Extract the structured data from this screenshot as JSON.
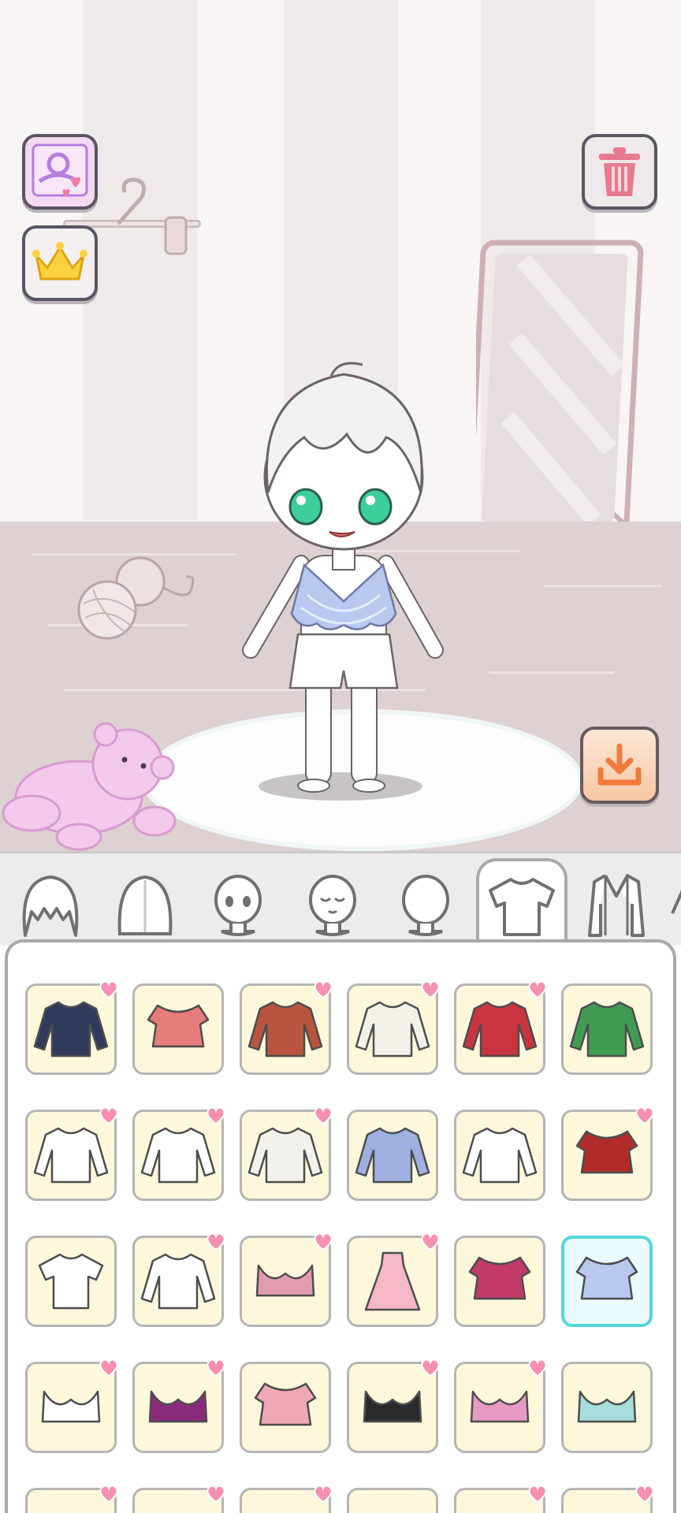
{
  "scene": {
    "buttons": [
      {
        "name": "diary-button",
        "icon": "heart-diary-icon"
      },
      {
        "name": "vip-button",
        "icon": "crown-icon"
      },
      {
        "name": "trash-button",
        "icon": "trash-icon"
      },
      {
        "name": "save-button",
        "icon": "download-icon"
      }
    ],
    "character": {
      "hair_color": "#f2f2f2",
      "eye_color": "#3ccf9a",
      "top_color": "#b8c8ee",
      "shorts_color": "#ffffff"
    }
  },
  "tabs": [
    {
      "name": "tab-hair-front",
      "icon": "hair-bangs-icon"
    },
    {
      "name": "tab-hair-back",
      "icon": "hair-back-icon"
    },
    {
      "name": "tab-eyes",
      "icon": "face-eyes-icon"
    },
    {
      "name": "tab-mouth",
      "icon": "face-mouth-icon"
    },
    {
      "name": "tab-face",
      "icon": "face-base-icon"
    },
    {
      "name": "tab-tops",
      "icon": "tshirt-icon",
      "active": true
    },
    {
      "name": "tab-jackets",
      "icon": "jacket-icon"
    },
    {
      "name": "tab-more",
      "icon": "partial-icon"
    }
  ],
  "items": [
    [
      {
        "icon": "sailor-jacket-icon",
        "color": "#2f3a5c",
        "heart": true
      },
      {
        "icon": "pink-crop-sweater-icon",
        "color": "#e77c7c",
        "heart": false
      },
      {
        "icon": "brown-bell-sleeve-icon",
        "color": "#b9553f",
        "heart": true
      },
      {
        "icon": "white-vneck-sweater-icon",
        "color": "#f4f1ea",
        "heart": true
      },
      {
        "icon": "red-cardigan-icon",
        "color": "#c8343f",
        "heart": true
      },
      {
        "icon": "green-floral-wrap-icon",
        "color": "#3f9c52",
        "heart": false
      }
    ],
    [
      {
        "icon": "white-button-shirt-icon",
        "color": "#ffffff",
        "heart": true
      },
      {
        "icon": "white-bow-blouse-icon",
        "color": "#ffffff",
        "heart": true
      },
      {
        "icon": "cable-knit-sweater-icon",
        "color": "#f3f1ec",
        "heart": true
      },
      {
        "icon": "blue-puff-blouse-icon",
        "color": "#9fb0e0",
        "heart": false
      },
      {
        "icon": "red-trim-blouse-icon",
        "color": "#ffffff",
        "heart": false
      },
      {
        "icon": "red-crop-top-icon",
        "color": "#b22b2b",
        "heart": true
      }
    ],
    [
      {
        "icon": "white-tshirt-icon",
        "color": "#ffffff",
        "heart": false
      },
      {
        "icon": "sailor-uniform-icon",
        "color": "#ffffff",
        "heart": true
      },
      {
        "icon": "pink-halter-top-icon",
        "color": "#e39bb0",
        "heart": true
      },
      {
        "icon": "pink-slip-dress-icon",
        "color": "#f6b7c7",
        "heart": true
      },
      {
        "icon": "magenta-peplum-top-icon",
        "color": "#c23a67",
        "heart": false
      },
      {
        "icon": "blue-ruffle-top-icon",
        "color": "#b8c8ee",
        "heart": false,
        "selected": true
      }
    ],
    [
      {
        "icon": "white-sports-bra-icon",
        "color": "#ffffff",
        "heart": true
      },
      {
        "icon": "purple-bandeau-icon",
        "color": "#8a2a7a",
        "heart": true
      },
      {
        "icon": "pink-bow-top-icon",
        "color": "#f0a8b6",
        "heart": false
      },
      {
        "icon": "black-lace-bra-icon",
        "color": "#2a2a2a",
        "heart": true
      },
      {
        "icon": "pink-pattern-bra-icon",
        "color": "#e79ac4",
        "heart": true
      },
      {
        "icon": "mint-bikini-top-icon",
        "color": "#a6dcdc",
        "heart": false
      }
    ]
  ]
}
